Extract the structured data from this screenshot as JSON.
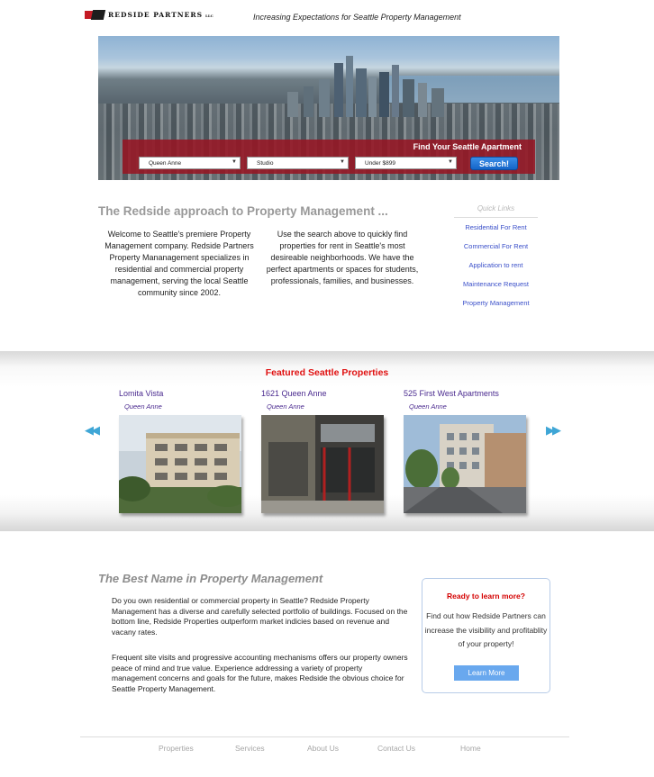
{
  "header": {
    "logo_text": "REDSIDE PARTNERS",
    "logo_suffix": "LLC",
    "tagline": "Increasing Expectations for Seattle Property Management"
  },
  "search": {
    "title": "Find Your Seattle Apartment",
    "neighborhood": "Queen Anne",
    "type": "Studio",
    "price": "Under $899",
    "button": "Search!"
  },
  "approach": {
    "title": "The Redside approach to Property Management ...",
    "col1": "Welcome to Seattle's premiere Property Management company. Redside Partners Property Mananagement specializes in residential and commercial property management, serving the local Seattle community since 2002.",
    "col2": "Use the search above to quickly find properties for rent in Seattle's most desireable neighborhoods. We have the perfect apartments or spaces for students, professionals, families, and businesses."
  },
  "quick_links": {
    "title": "Quick Links",
    "items": [
      {
        "label": "Residential For Rent"
      },
      {
        "label": "Commercial For Rent"
      },
      {
        "label": "Application to rent"
      },
      {
        "label": "Maintenance Request"
      },
      {
        "label": "Property Management"
      }
    ]
  },
  "featured": {
    "title": "Featured Seattle Properties",
    "properties": [
      {
        "name": "Lomita Vista",
        "area": "Queen Anne"
      },
      {
        "name": "1621 Queen Anne",
        "area": "Queen Anne"
      },
      {
        "name": "525 First West Apartments",
        "area": "Queen Anne"
      }
    ]
  },
  "best": {
    "title": "The Best Name in Property Management",
    "p1": "Do you own residential or commercial property in Seattle? Redside Property Management has a diverse and carefully selected portfolio of buildings. Focused on the bottom line, Redside Properties outperform market indicies based on revenue and vacany rates.",
    "p2": "Frequent site visits and progressive accounting mechanisms offers our property owners peace of mind and true value. Experience addressing a variety of property management concerns and goals for the future, makes Redside the obvious choice for Seattle Property Management."
  },
  "cta": {
    "title": "Ready to learn more?",
    "text": "Find out how Redside Partners can increase the visibility and profitablity of your property!",
    "button": "Learn More"
  },
  "footer": {
    "links": [
      {
        "label": "Properties"
      },
      {
        "label": "Services"
      },
      {
        "label": "About Us"
      },
      {
        "label": "Contact Us"
      },
      {
        "label": "Home"
      }
    ]
  },
  "colors": {
    "brand_red": "#c41a24",
    "link_blue": "#3a4fc9",
    "featured_red": "#e01010",
    "arrow_blue": "#3fa6d6"
  },
  "icons": [
    "arrow-left-icon",
    "arrow-right-icon",
    "dropdown-caret-icon"
  ]
}
